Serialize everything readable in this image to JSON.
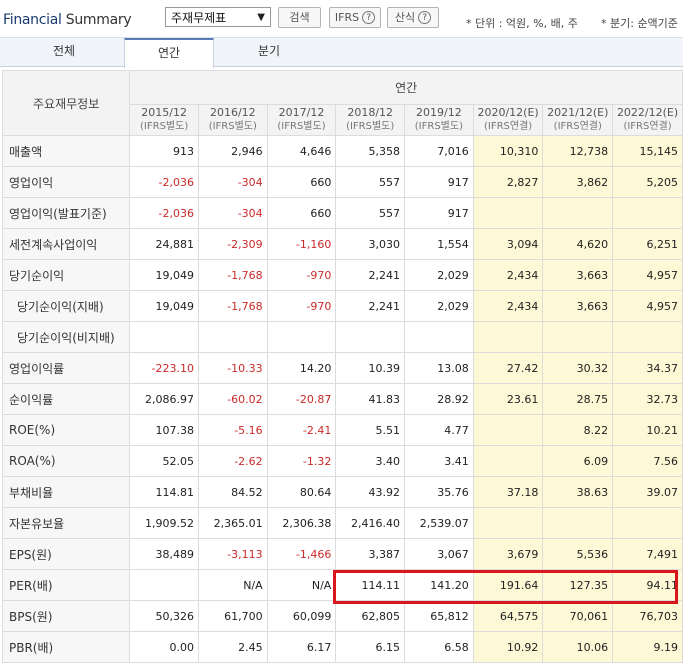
{
  "header": {
    "title_part1": "Financial",
    "title_part2": "Summary",
    "select_value": "주재무제표",
    "search_label": "검색",
    "ifrs_label": "IFRS",
    "formula_label": "산식",
    "help_glyph": "?",
    "unit_note": "* 단위 : 억원, %, 배, 주",
    "period_note": "* 분기: 순액기준"
  },
  "tabs": [
    "전체",
    "연간",
    "분기"
  ],
  "table": {
    "corner_label": "주요재무정보",
    "group_label": "연간",
    "columns": [
      {
        "period": "2015/12",
        "basis": "(IFRS별도)"
      },
      {
        "period": "2016/12",
        "basis": "(IFRS별도)"
      },
      {
        "period": "2017/12",
        "basis": "(IFRS별도)"
      },
      {
        "period": "2018/12",
        "basis": "(IFRS별도)"
      },
      {
        "period": "2019/12",
        "basis": "(IFRS별도)"
      },
      {
        "period": "2020/12(E)",
        "basis": "(IFRS연결)"
      },
      {
        "period": "2021/12(E)",
        "basis": "(IFRS연결)"
      },
      {
        "period": "2022/12(E)",
        "basis": "(IFRS연결)"
      }
    ],
    "rows": [
      {
        "label": "매출액",
        "indent": false,
        "values": [
          "913",
          "2,946",
          "4,646",
          "5,358",
          "7,016",
          "10,310",
          "12,738",
          "15,145"
        ]
      },
      {
        "label": "영업이익",
        "indent": false,
        "values": [
          "-2,036",
          "-304",
          "660",
          "557",
          "917",
          "2,827",
          "3,862",
          "5,205"
        ]
      },
      {
        "label": "영업이익(발표기준)",
        "indent": false,
        "values": [
          "-2,036",
          "-304",
          "660",
          "557",
          "917",
          "",
          "",
          ""
        ]
      },
      {
        "label": "세전계속사업이익",
        "indent": false,
        "values": [
          "24,881",
          "-2,309",
          "-1,160",
          "3,030",
          "1,554",
          "3,094",
          "4,620",
          "6,251"
        ]
      },
      {
        "label": "당기순이익",
        "indent": false,
        "values": [
          "19,049",
          "-1,768",
          "-970",
          "2,241",
          "2,029",
          "2,434",
          "3,663",
          "4,957"
        ]
      },
      {
        "label": "당기순이익(지배)",
        "indent": true,
        "values": [
          "19,049",
          "-1,768",
          "-970",
          "2,241",
          "2,029",
          "2,434",
          "3,663",
          "4,957"
        ]
      },
      {
        "label": "당기순이익(비지배)",
        "indent": true,
        "values": [
          "",
          "",
          "",
          "",
          "",
          "",
          "",
          ""
        ]
      },
      {
        "label": "영업이익률",
        "indent": false,
        "values": [
          "-223.10",
          "-10.33",
          "14.20",
          "10.39",
          "13.08",
          "27.42",
          "30.32",
          "34.37"
        ]
      },
      {
        "label": "순이익률",
        "indent": false,
        "values": [
          "2,086.97",
          "-60.02",
          "-20.87",
          "41.83",
          "28.92",
          "23.61",
          "28.75",
          "32.73"
        ]
      },
      {
        "label": "ROE(%)",
        "indent": false,
        "values": [
          "107.38",
          "-5.16",
          "-2.41",
          "5.51",
          "4.77",
          "",
          "8.22",
          "10.21"
        ]
      },
      {
        "label": "ROA(%)",
        "indent": false,
        "values": [
          "52.05",
          "-2.62",
          "-1.32",
          "3.40",
          "3.41",
          "",
          "6.09",
          "7.56"
        ]
      },
      {
        "label": "부채비율",
        "indent": false,
        "values": [
          "114.81",
          "84.52",
          "80.64",
          "43.92",
          "35.76",
          "37.18",
          "38.63",
          "39.07"
        ]
      },
      {
        "label": "자본유보율",
        "indent": false,
        "values": [
          "1,909.52",
          "2,365.01",
          "2,306.38",
          "2,416.40",
          "2,539.07",
          "",
          "",
          ""
        ]
      },
      {
        "label": "EPS(원)",
        "indent": false,
        "values": [
          "38,489",
          "-3,113",
          "-1,466",
          "3,387",
          "3,067",
          "3,679",
          "5,536",
          "7,491"
        ]
      },
      {
        "label": "PER(배)",
        "indent": false,
        "values": [
          "",
          "N/A",
          "N/A",
          "114.11",
          "141.20",
          "191.64",
          "127.35",
          "94.11"
        ]
      },
      {
        "label": "BPS(원)",
        "indent": false,
        "values": [
          "50,326",
          "61,700",
          "60,099",
          "62,805",
          "65,812",
          "64,575",
          "70,061",
          "76,703"
        ]
      },
      {
        "label": "PBR(배)",
        "indent": false,
        "values": [
          "0.00",
          "2.45",
          "6.17",
          "6.15",
          "6.58",
          "10.92",
          "10.06",
          "9.19"
        ]
      }
    ],
    "highlight_row_label": "PER(배)",
    "colors": {
      "negative": "#cc2a2a",
      "estimate_bg": "#fdf8d6",
      "highlight_border": "#d9161b"
    }
  }
}
